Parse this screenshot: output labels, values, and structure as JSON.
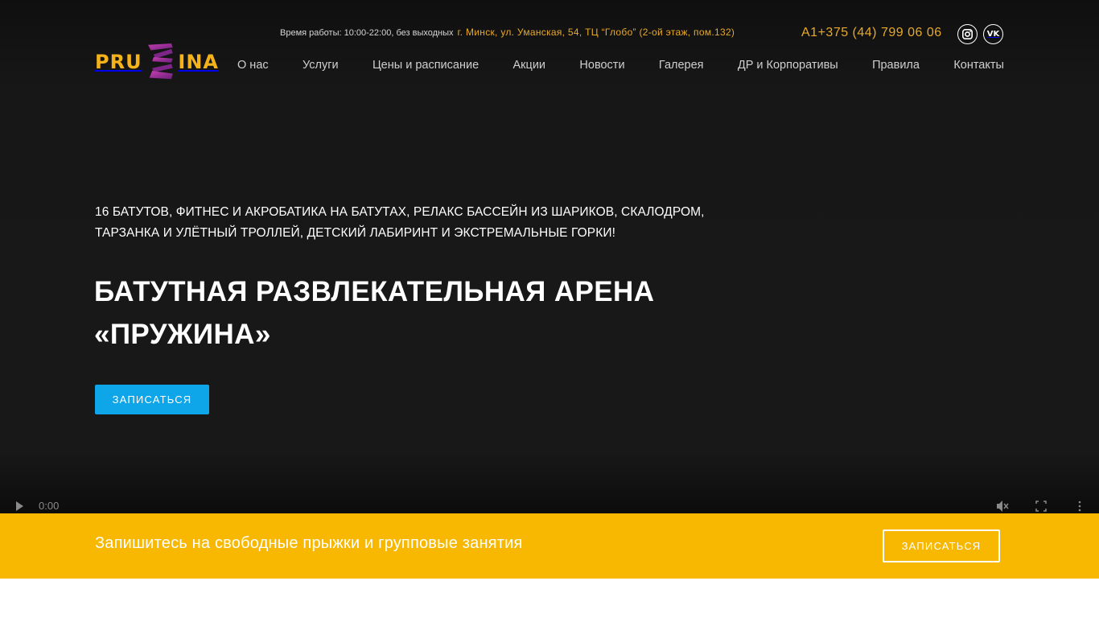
{
  "header": {
    "logo": {
      "left": "PRU",
      "right": "INA"
    },
    "hours": "Время работы: 10:00-22:00, без выходных",
    "address": "г. Минск, ул. Уманская, 54, ТЦ “Глобо” (2-ой этаж, пом.132)",
    "phone": "A1+375 (44) 799 06 06",
    "social": [
      {
        "name": "instagram",
        "icon": "instagram-icon"
      },
      {
        "name": "vk",
        "icon": "vk-icon",
        "glyph": "VK"
      }
    ],
    "nav": [
      "О нас",
      "Услуги",
      "Цены и расписание",
      "Акции",
      "Новости",
      "Галерея",
      "ДР и Корпоративы",
      "Правила",
      "Контакты"
    ]
  },
  "hero": {
    "lead": "16 БАТУТОВ, ФИТНЕС И АКРОБАТИКА НА БАТУТАХ, РЕЛАКС БАССЕЙН ИЗ ШАРИКОВ, СКАЛОДРОМ, ТАРЗАНКА И УЛЁТНЫЙ ТРОЛЛЕЙ, ДЕТСКИЙ ЛАБИРИНТ И ЭКСТРЕМАЛЬНЫЕ ГОРКИ!",
    "title": "БАТУТНАЯ РАЗВЛЕКАТЕЛЬНАЯ АРЕНА «ПРУЖИНА»",
    "button": "ЗАПИСАТЬСЯ"
  },
  "video": {
    "time": "0:00"
  },
  "banner": {
    "text": "Запишитесь на свободные прыжки и групповые занятия",
    "button": "ЗАПИСАТЬСЯ"
  },
  "colors": {
    "accent_yellow": "#f8b700",
    "accent_blue": "#0ea5e9",
    "hero_bg": "#181818",
    "logo_purple": "#9b2d8f"
  }
}
